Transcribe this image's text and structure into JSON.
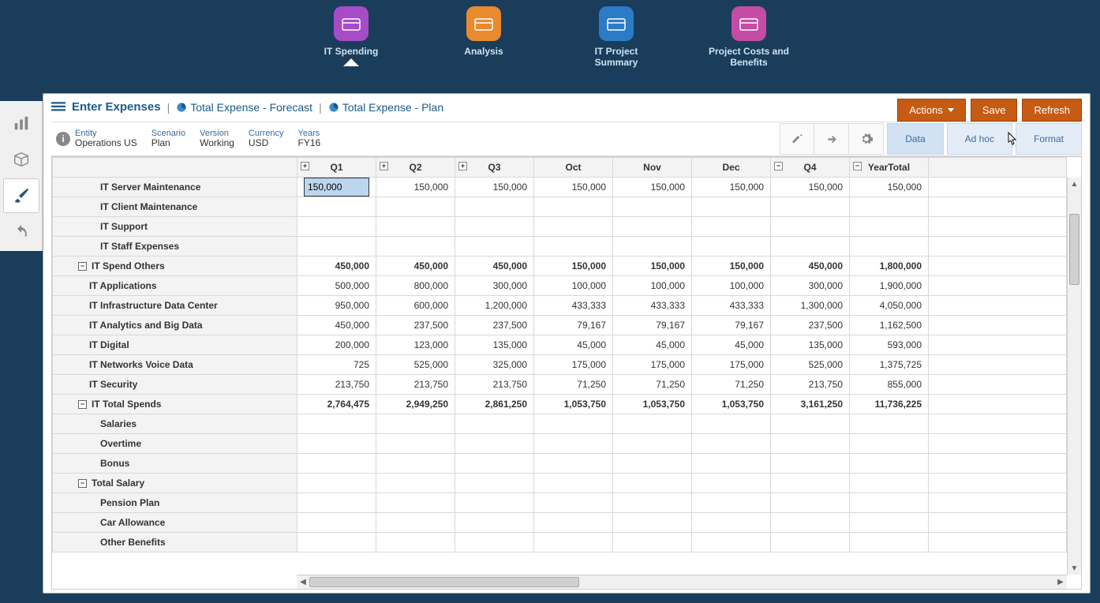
{
  "nav": [
    {
      "label": "IT Spending",
      "color": "tile-purple",
      "active": true
    },
    {
      "label": "Analysis",
      "color": "tile-orange",
      "active": false
    },
    {
      "label": "IT Project Summary",
      "color": "tile-blue",
      "active": false
    },
    {
      "label": "Project Costs and Benefits",
      "color": "tile-pink",
      "active": false
    }
  ],
  "breadcrumb": {
    "first": "Enter Expenses",
    "items": [
      "Total Expense - Forecast",
      "Total Expense - Plan"
    ]
  },
  "actions": {
    "actions": "Actions",
    "save": "Save",
    "refresh": "Refresh"
  },
  "pov": [
    {
      "label": "Entity",
      "value": "Operations US"
    },
    {
      "label": "Scenario",
      "value": "Plan"
    },
    {
      "label": "Version",
      "value": "Working"
    },
    {
      "label": "Currency",
      "value": "USD"
    },
    {
      "label": "Years",
      "value": "FY16"
    }
  ],
  "tabs": {
    "data": "Data",
    "adhoc": "Ad hoc",
    "format": "Format"
  },
  "columns": [
    "Q1",
    "Q2",
    "Q3",
    "Oct",
    "Nov",
    "Dec",
    "Q4",
    "YearTotal"
  ],
  "col_expand": {
    "Q1": "plus",
    "Q2": "plus",
    "Q3": "plus",
    "Q4": "minus",
    "YearTotal": "minus"
  },
  "editing_cell": {
    "row": 0,
    "col": 0,
    "value": "150,000"
  },
  "rows": [
    {
      "label": "IT Server Maintenance",
      "indent": 1,
      "group": false,
      "vals": [
        "150,000",
        "150,000",
        "150,000",
        "150,000",
        "150,000",
        "150,000",
        "150,000",
        "150,000"
      ]
    },
    {
      "label": "IT Client Maintenance",
      "indent": 1,
      "group": false,
      "vals": [
        "",
        "",
        "",
        "",
        "",
        "",
        "",
        ""
      ]
    },
    {
      "label": "IT Support",
      "indent": 1,
      "group": false,
      "vals": [
        "",
        "",
        "",
        "",
        "",
        "",
        "",
        ""
      ]
    },
    {
      "label": "IT Staff Expenses",
      "indent": 1,
      "group": false,
      "vals": [
        "",
        "",
        "",
        "",
        "",
        "",
        "",
        ""
      ]
    },
    {
      "label": "IT Spend Others",
      "indent": 0,
      "group": true,
      "toggle": "minus",
      "vals": [
        "450,000",
        "450,000",
        "450,000",
        "150,000",
        "150,000",
        "150,000",
        "450,000",
        "1,800,000"
      ]
    },
    {
      "label": "IT Applications",
      "indent": 2,
      "group": false,
      "vals": [
        "500,000",
        "800,000",
        "300,000",
        "100,000",
        "100,000",
        "100,000",
        "300,000",
        "1,900,000"
      ]
    },
    {
      "label": "IT Infrastructure Data Center",
      "indent": 2,
      "group": false,
      "vals": [
        "950,000",
        "600,000",
        "1,200,000",
        "433,333",
        "433,333",
        "433,333",
        "1,300,000",
        "4,050,000"
      ]
    },
    {
      "label": "IT Analytics and Big Data",
      "indent": 2,
      "group": false,
      "vals": [
        "450,000",
        "237,500",
        "237,500",
        "79,167",
        "79,167",
        "79,167",
        "237,500",
        "1,162,500"
      ]
    },
    {
      "label": "IT Digital",
      "indent": 2,
      "group": false,
      "vals": [
        "200,000",
        "123,000",
        "135,000",
        "45,000",
        "45,000",
        "45,000",
        "135,000",
        "593,000"
      ]
    },
    {
      "label": "IT Networks Voice Data",
      "indent": 2,
      "group": false,
      "vals": [
        "725",
        "525,000",
        "325,000",
        "175,000",
        "175,000",
        "175,000",
        "525,000",
        "1,375,725"
      ]
    },
    {
      "label": "IT Security",
      "indent": 2,
      "group": false,
      "vals": [
        "213,750",
        "213,750",
        "213,750",
        "71,250",
        "71,250",
        "71,250",
        "213,750",
        "855,000"
      ]
    },
    {
      "label": "IT Total Spends",
      "indent": 0,
      "group": true,
      "toggle": "minus",
      "vals": [
        "2,764,475",
        "2,949,250",
        "2,861,250",
        "1,053,750",
        "1,053,750",
        "1,053,750",
        "3,161,250",
        "11,736,225"
      ]
    },
    {
      "label": "Salaries",
      "indent": 1,
      "group": false,
      "vals": [
        "",
        "",
        "",
        "",
        "",
        "",
        "",
        ""
      ]
    },
    {
      "label": "Overtime",
      "indent": 1,
      "group": false,
      "vals": [
        "",
        "",
        "",
        "",
        "",
        "",
        "",
        ""
      ]
    },
    {
      "label": "Bonus",
      "indent": 1,
      "group": false,
      "vals": [
        "",
        "",
        "",
        "",
        "",
        "",
        "",
        ""
      ]
    },
    {
      "label": "Total Salary",
      "indent": 0,
      "group": true,
      "toggle": "minus",
      "vals": [
        "",
        "",
        "",
        "",
        "",
        "",
        "",
        ""
      ]
    },
    {
      "label": "Pension Plan",
      "indent": 1,
      "group": false,
      "vals": [
        "",
        "",
        "",
        "",
        "",
        "",
        "",
        ""
      ]
    },
    {
      "label": "Car Allowance",
      "indent": 1,
      "group": false,
      "vals": [
        "",
        "",
        "",
        "",
        "",
        "",
        "",
        ""
      ]
    },
    {
      "label": "Other Benefits",
      "indent": 1,
      "group": false,
      "vals": [
        "",
        "",
        "",
        "",
        "",
        "",
        "",
        ""
      ]
    }
  ]
}
